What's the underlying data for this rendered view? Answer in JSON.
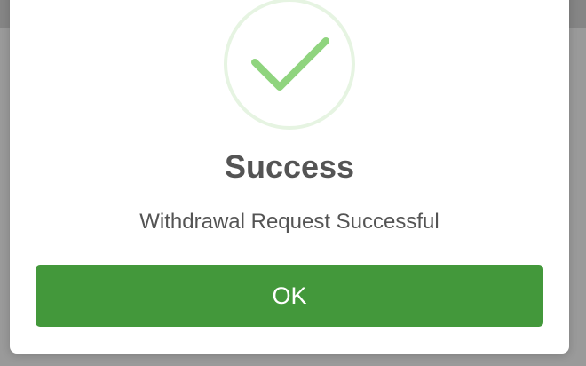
{
  "dialog": {
    "icon": "check-circle-icon",
    "title": "Success",
    "message": "Withdrawal Request Successful",
    "ok_label": "OK"
  },
  "colors": {
    "accent": "#43983b",
    "icon_stroke": "#8fd47e",
    "icon_ring": "#e6f4e2",
    "text": "#545454",
    "backdrop": "#9a9a9a"
  }
}
